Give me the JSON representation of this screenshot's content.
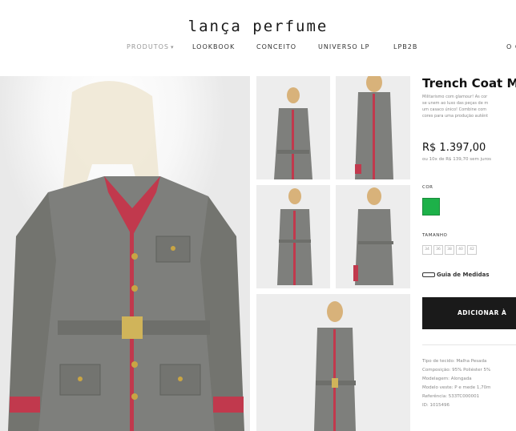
{
  "brand": {
    "logo": "lança perfume"
  },
  "nav": {
    "items": [
      "PRODUTOS",
      "LOOKBOOK",
      "CONCEITO",
      "UNIVERSO LP",
      "LPB2B",
      "O Q"
    ]
  },
  "product": {
    "name": "Trench Coat Mil",
    "description_lines": [
      "Militarismo com glamour! As cor",
      "se unem ao luxo das peças de m",
      "um casaco único! Combine com",
      "cores para uma produção autênt"
    ],
    "price": "R$ 1.397,00",
    "installments": "ou 10x de R$ 139,70 sem juros",
    "color_label": "COR",
    "color_hex": "#1db149",
    "size_label": "TAMANHO",
    "sizes": [
      "34",
      "36",
      "38",
      "40",
      "42"
    ],
    "size_guide": "Guia de Medidas",
    "add_button": "ADICIONAR À",
    "specs": [
      "Tipo de tecido:  Malha Pesada",
      "Composição:  95% Poliéster 5%",
      "Modelagem:  Alongada",
      "Modelo veste:  P e mede 1,70m",
      "Referência:  533TC000001",
      "ID:  1015496"
    ]
  },
  "colors": {
    "coat": "#7e7f7c",
    "trim": "#c1394d",
    "button_dark": "#1a1a1a"
  }
}
